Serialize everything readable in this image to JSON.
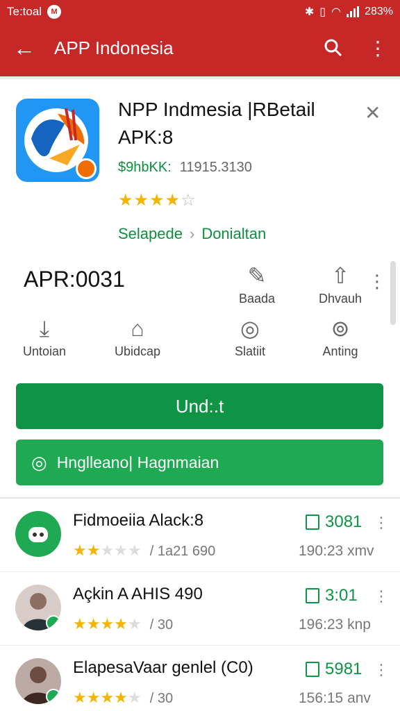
{
  "status": {
    "carrier": "Te:toal",
    "right_text": "283%"
  },
  "appbar": {
    "title": "APP Indonesia"
  },
  "app": {
    "name": "NPP Indmesia |RBetail APK:8",
    "developer": "$9hbKK:",
    "size": "11915.3130",
    "rating_stars": 4,
    "breadcrumb": [
      "Selapede",
      "Donialtan"
    ]
  },
  "version": "APR:0031",
  "top_actions": [
    {
      "icon": "pin-icon",
      "label": "Baada"
    },
    {
      "icon": "share-icon",
      "label": "Dhvauh"
    }
  ],
  "actions": [
    {
      "icon": "download-icon",
      "label": "Untoian"
    },
    {
      "icon": "folder-icon",
      "label": "Ubidcap"
    },
    {
      "icon": "location-icon",
      "label": "Slatiit"
    },
    {
      "icon": "lock-icon",
      "label": "Anting"
    }
  ],
  "buttons": {
    "primary": "Und:.t",
    "secondary": "Hnglleano| Hagnmaian"
  },
  "reviews": [
    {
      "name": "Fidmoeiia Alack:8",
      "stars": 2,
      "count_text": "/ 1a21 690",
      "value": "3081",
      "date": "190:23 xmv",
      "avatar_color": "#1ea952"
    },
    {
      "name": "Açkin A AHIS 490",
      "stars": 4,
      "count_text": "/ 30",
      "value": "3:01",
      "date": "196:23 knp",
      "avatar_color": "#5d4037"
    },
    {
      "name": "ElapesaVaar genlel (C0)",
      "stars": 4,
      "count_text": "/ 30",
      "value": "5981",
      "date": "156:15 anv",
      "avatar_color": "#4e342e"
    }
  ],
  "colors": {
    "brand_red": "#c62828",
    "green": "#0e9444",
    "star": "#f4b400"
  }
}
